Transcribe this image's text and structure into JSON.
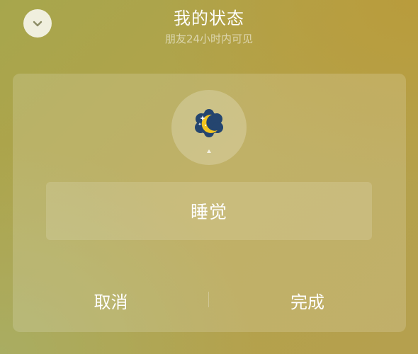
{
  "header": {
    "title": "我的状态",
    "subtitle": "朋友24小时内可见",
    "collapse_icon": "chevron-down-icon"
  },
  "status": {
    "emoji_icon": "crescent-moon-with-stars-icon",
    "text": "睡觉"
  },
  "actions": {
    "cancel_label": "取消",
    "done_label": "完成"
  },
  "colors": {
    "background_primary": "#b0a24a",
    "background_accent": "#a9ad62",
    "moon_cloud": "#24456f",
    "moon": "#f3c51e",
    "text": "#ffffff"
  }
}
